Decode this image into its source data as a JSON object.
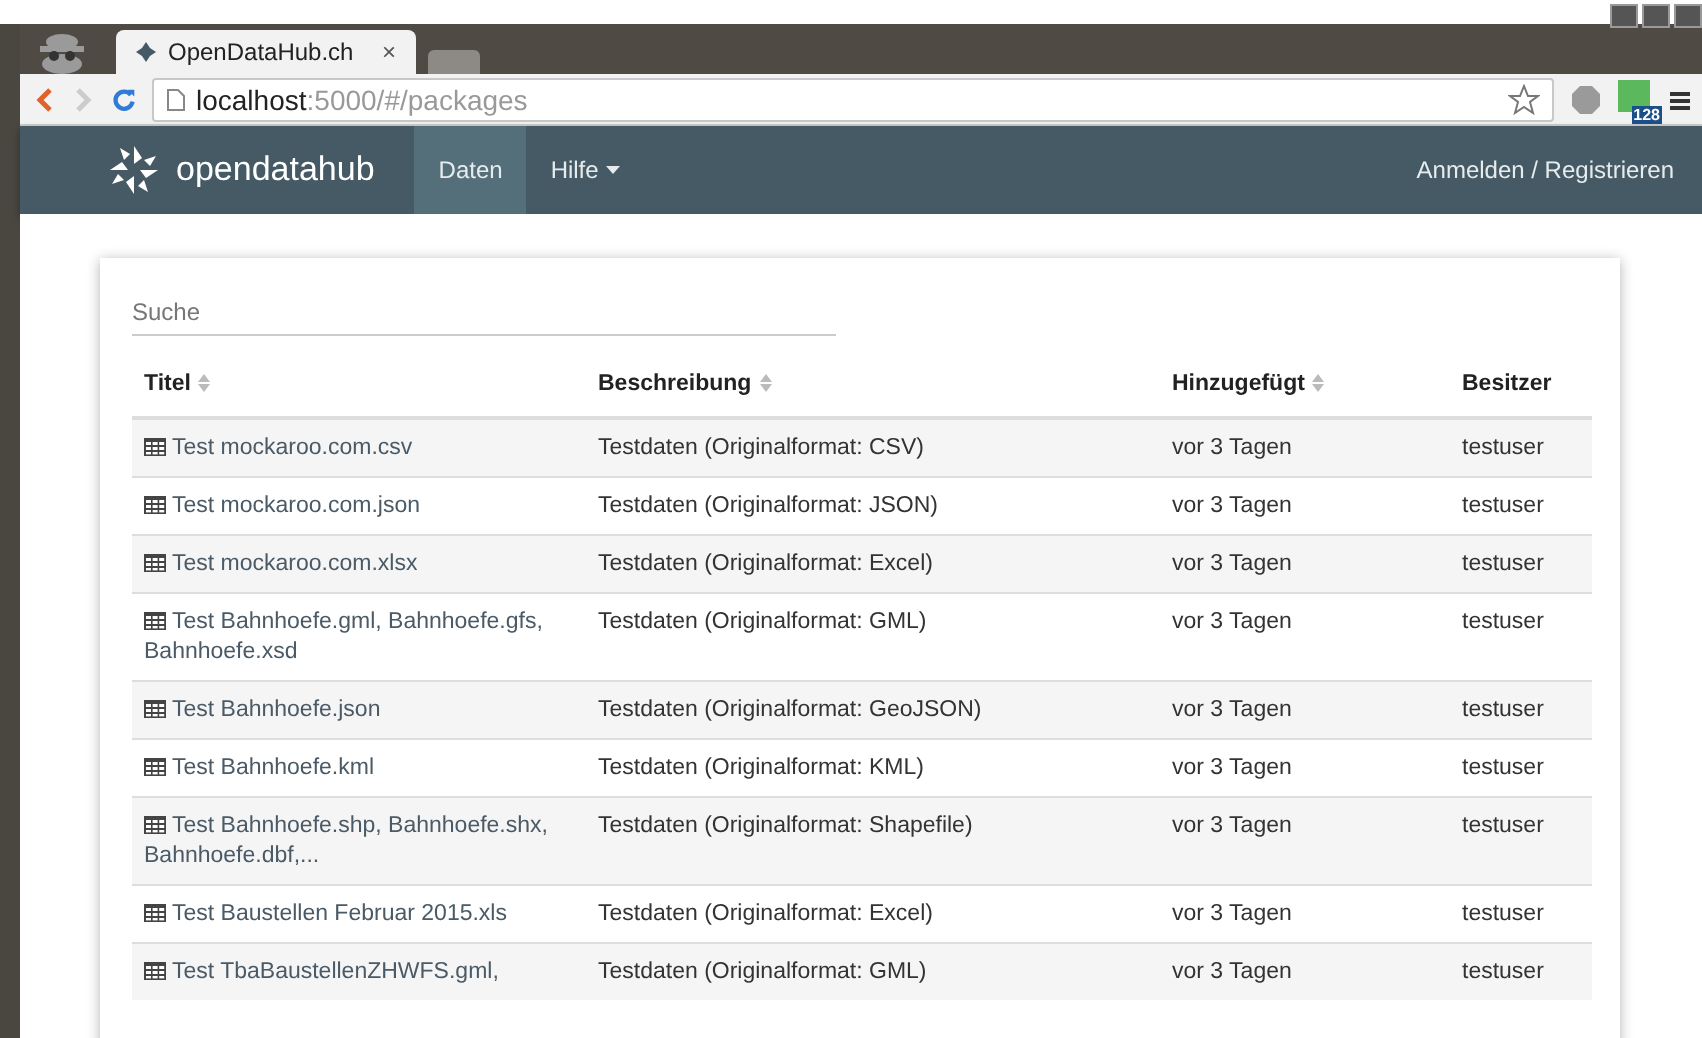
{
  "browser": {
    "tab": {
      "title": "OpenDataHub.ch",
      "close": "×"
    },
    "url": "**localhost**:5000/#/packages",
    "extension_badge": "128"
  },
  "navbar": {
    "brand": "opendatahub",
    "items": [
      {
        "label": "Daten",
        "selected": true,
        "dropdown": false
      },
      {
        "label": "Hilfe",
        "selected": false,
        "dropdown": true
      }
    ],
    "login": "Anmelden / Registrieren"
  },
  "search": {
    "placeholder": "Suche"
  },
  "table": {
    "columns": [
      {
        "label": "Titel",
        "sortable": true
      },
      {
        "label": "Beschreibung",
        "sortable": true
      },
      {
        "label": "Hinzugefügt",
        "sortable": true
      },
      {
        "label": "Besitzer",
        "sortable": false
      }
    ],
    "rows": [
      {
        "title": "Test mockaroo.com.csv",
        "description": "Testdaten (Originalformat: CSV)",
        "added": "vor 3 Tagen",
        "owner": "testuser"
      },
      {
        "title": "Test mockaroo.com.json",
        "description": "Testdaten (Originalformat: JSON)",
        "added": "vor 3 Tagen",
        "owner": "testuser"
      },
      {
        "title": "Test mockaroo.com.xlsx",
        "description": "Testdaten (Originalformat: Excel)",
        "added": "vor 3 Tagen",
        "owner": "testuser"
      },
      {
        "title": "Test Bahnhoefe.gml, Bahnhoefe.gfs, Bahnhoefe.xsd",
        "description": "Testdaten (Originalformat: GML)",
        "added": "vor 3 Tagen",
        "owner": "testuser"
      },
      {
        "title": "Test Bahnhoefe.json",
        "description": "Testdaten (Originalformat: GeoJSON)",
        "added": "vor 3 Tagen",
        "owner": "testuser"
      },
      {
        "title": "Test Bahnhoefe.kml",
        "description": "Testdaten (Originalformat: KML)",
        "added": "vor 3 Tagen",
        "owner": "testuser"
      },
      {
        "title": "Test Bahnhoefe.shp, Bahnhoefe.shx, Bahnhoefe.dbf,...",
        "description": "Testdaten (Originalformat: Shapefile)",
        "added": "vor 3 Tagen",
        "owner": "testuser"
      },
      {
        "title": "Test Baustellen Februar 2015.xls",
        "description": "Testdaten (Originalformat: Excel)",
        "added": "vor 3 Tagen",
        "owner": "testuser"
      },
      {
        "title": "Test TbaBaustellenZHWFS.gml,",
        "description": "Testdaten (Originalformat: GML)",
        "added": "vor 3 Tagen",
        "owner": "testuser"
      }
    ]
  }
}
